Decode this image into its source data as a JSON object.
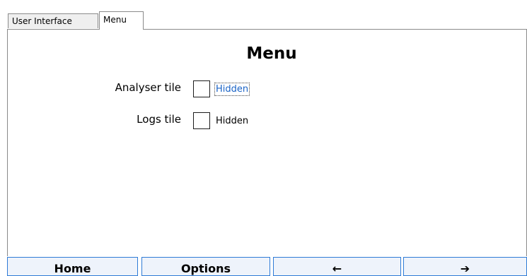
{
  "tabs": [
    {
      "label": "User Interface",
      "active": false
    },
    {
      "label": "Menu",
      "active": true
    }
  ],
  "page": {
    "title": "Menu"
  },
  "settings": [
    {
      "label": "Analyser tile",
      "checked": false,
      "state": "Hidden"
    },
    {
      "label": "Logs tile",
      "checked": false,
      "state": "Hidden"
    }
  ],
  "navbar": {
    "home": "Home",
    "options": "Options",
    "back": "←",
    "forward": "➔"
  },
  "colors": {
    "focus_text": "#1a63c6",
    "nav_border": "#2e7bd6"
  }
}
